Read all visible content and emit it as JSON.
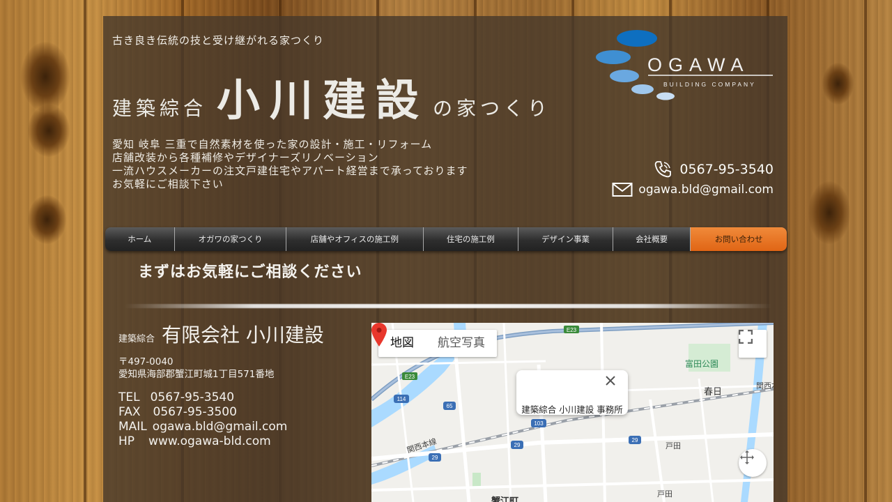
{
  "header": {
    "tagline": "古き良き伝統の技と受け継がれる家つくり",
    "title_prefix": "建築綜合",
    "title_name": "小川建設",
    "title_suffix": "の家つくり",
    "logo_text": "OGAWA",
    "logo_subtext": "BUILDING COMPANY",
    "intro_lines": [
      "愛知 岐阜 三重で自然素材を使った家の設計・施工・リフォーム",
      "店舗改装から各種補修やデザイナーズリノベーション",
      "一流ハウスメーカーの注文戸建住宅やアパート経営まで承っております",
      "お気軽にご相談下さい"
    ],
    "phone": "0567-95-3540",
    "email": "ogawa.bld@gmail.com"
  },
  "nav": {
    "items": [
      {
        "label": "ホーム"
      },
      {
        "label": "オガワの家つくり"
      },
      {
        "label": "店舗やオフィスの施工例"
      },
      {
        "label": "住宅の施工例"
      },
      {
        "label": "デザイン事業"
      },
      {
        "label": "会社概要"
      },
      {
        "label": "お問い合わせ"
      }
    ],
    "active_index": 6,
    "active_color": "#ef7a25"
  },
  "section": {
    "heading": "まずはお気軽にご相談ください"
  },
  "company": {
    "prefix": "建築綜合",
    "name": "有限会社 小川建設",
    "zip": "〒497-0040",
    "address": "愛知県海部郡蟹江町城1丁目571番地",
    "tel_label": "TEL",
    "tel": "0567-95-3540",
    "fax_label": "FAX",
    "fax": "0567-95-3500",
    "mail_label": "MAIL",
    "mail": "ogawa.bld@gmail.com",
    "hp_label": "HP",
    "hp": "www.ogawa-bld.com"
  },
  "map": {
    "type_map": "地図",
    "type_satellite": "航空写真",
    "infowindow_text": "建築綜合 小川建設 事務所",
    "labels": {
      "park": "富田公園",
      "kasuga": "春日",
      "kansai": "関西本",
      "kansai_line": "関西本線",
      "toda": "戸田",
      "toda_station": "戸田",
      "kanie": "蟹江町",
      "e23": "E23",
      "r114": "114",
      "r65": "65",
      "r103": "103",
      "r29a": "29",
      "r29b": "29",
      "r29c": "29"
    }
  }
}
